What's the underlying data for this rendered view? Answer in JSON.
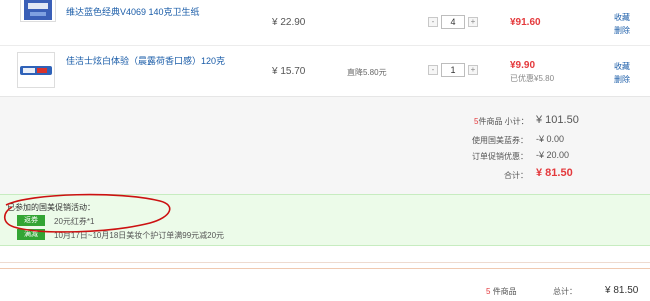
{
  "items": [
    {
      "name": "维达蓝色经典V4069 140克卫生纸",
      "price": "¥ 22.90",
      "quantity": "4",
      "subtotal": "¥91.60",
      "actions": [
        "收藏",
        "删除"
      ]
    },
    {
      "name": "佳洁士炫白体验（晨露荷香口感）120克",
      "price": "¥ 15.70",
      "tag": "直降5.80元",
      "quantity": "1",
      "subtotal": "¥9.90",
      "saved": "已优惠¥5.80",
      "actions": [
        "收藏",
        "删除"
      ]
    }
  ],
  "qty_controls": {
    "minus": "-",
    "plus": "+"
  },
  "summary": {
    "count": "5",
    "count_label": "件商品 小计：",
    "subtotal_value": "¥ 101.50",
    "coupon_label": "使用国美蓝券：",
    "coupon_value": "-¥ 0.00",
    "promo_label": "订单促销优惠：",
    "promo_value": "-¥ 20.00",
    "total_label": "合计：",
    "total_value": "¥ 81.50"
  },
  "promotions": {
    "title": "已参加的国美促销活动：",
    "entries": [
      {
        "badge": "返券",
        "text": "20元红券*1"
      },
      {
        "badge": "满减",
        "text": "10月17日~10月18日美妆个护订单满99元减20元"
      }
    ]
  },
  "footer": {
    "count": "5",
    "count_label": "件商品",
    "total_label": "总计：",
    "total_value": "¥ 81.50"
  },
  "colors": {
    "link": "#1a5ca8",
    "price_red": "#e4393c",
    "promo_green": "#33a534",
    "annotation_red": "#cc1111"
  }
}
